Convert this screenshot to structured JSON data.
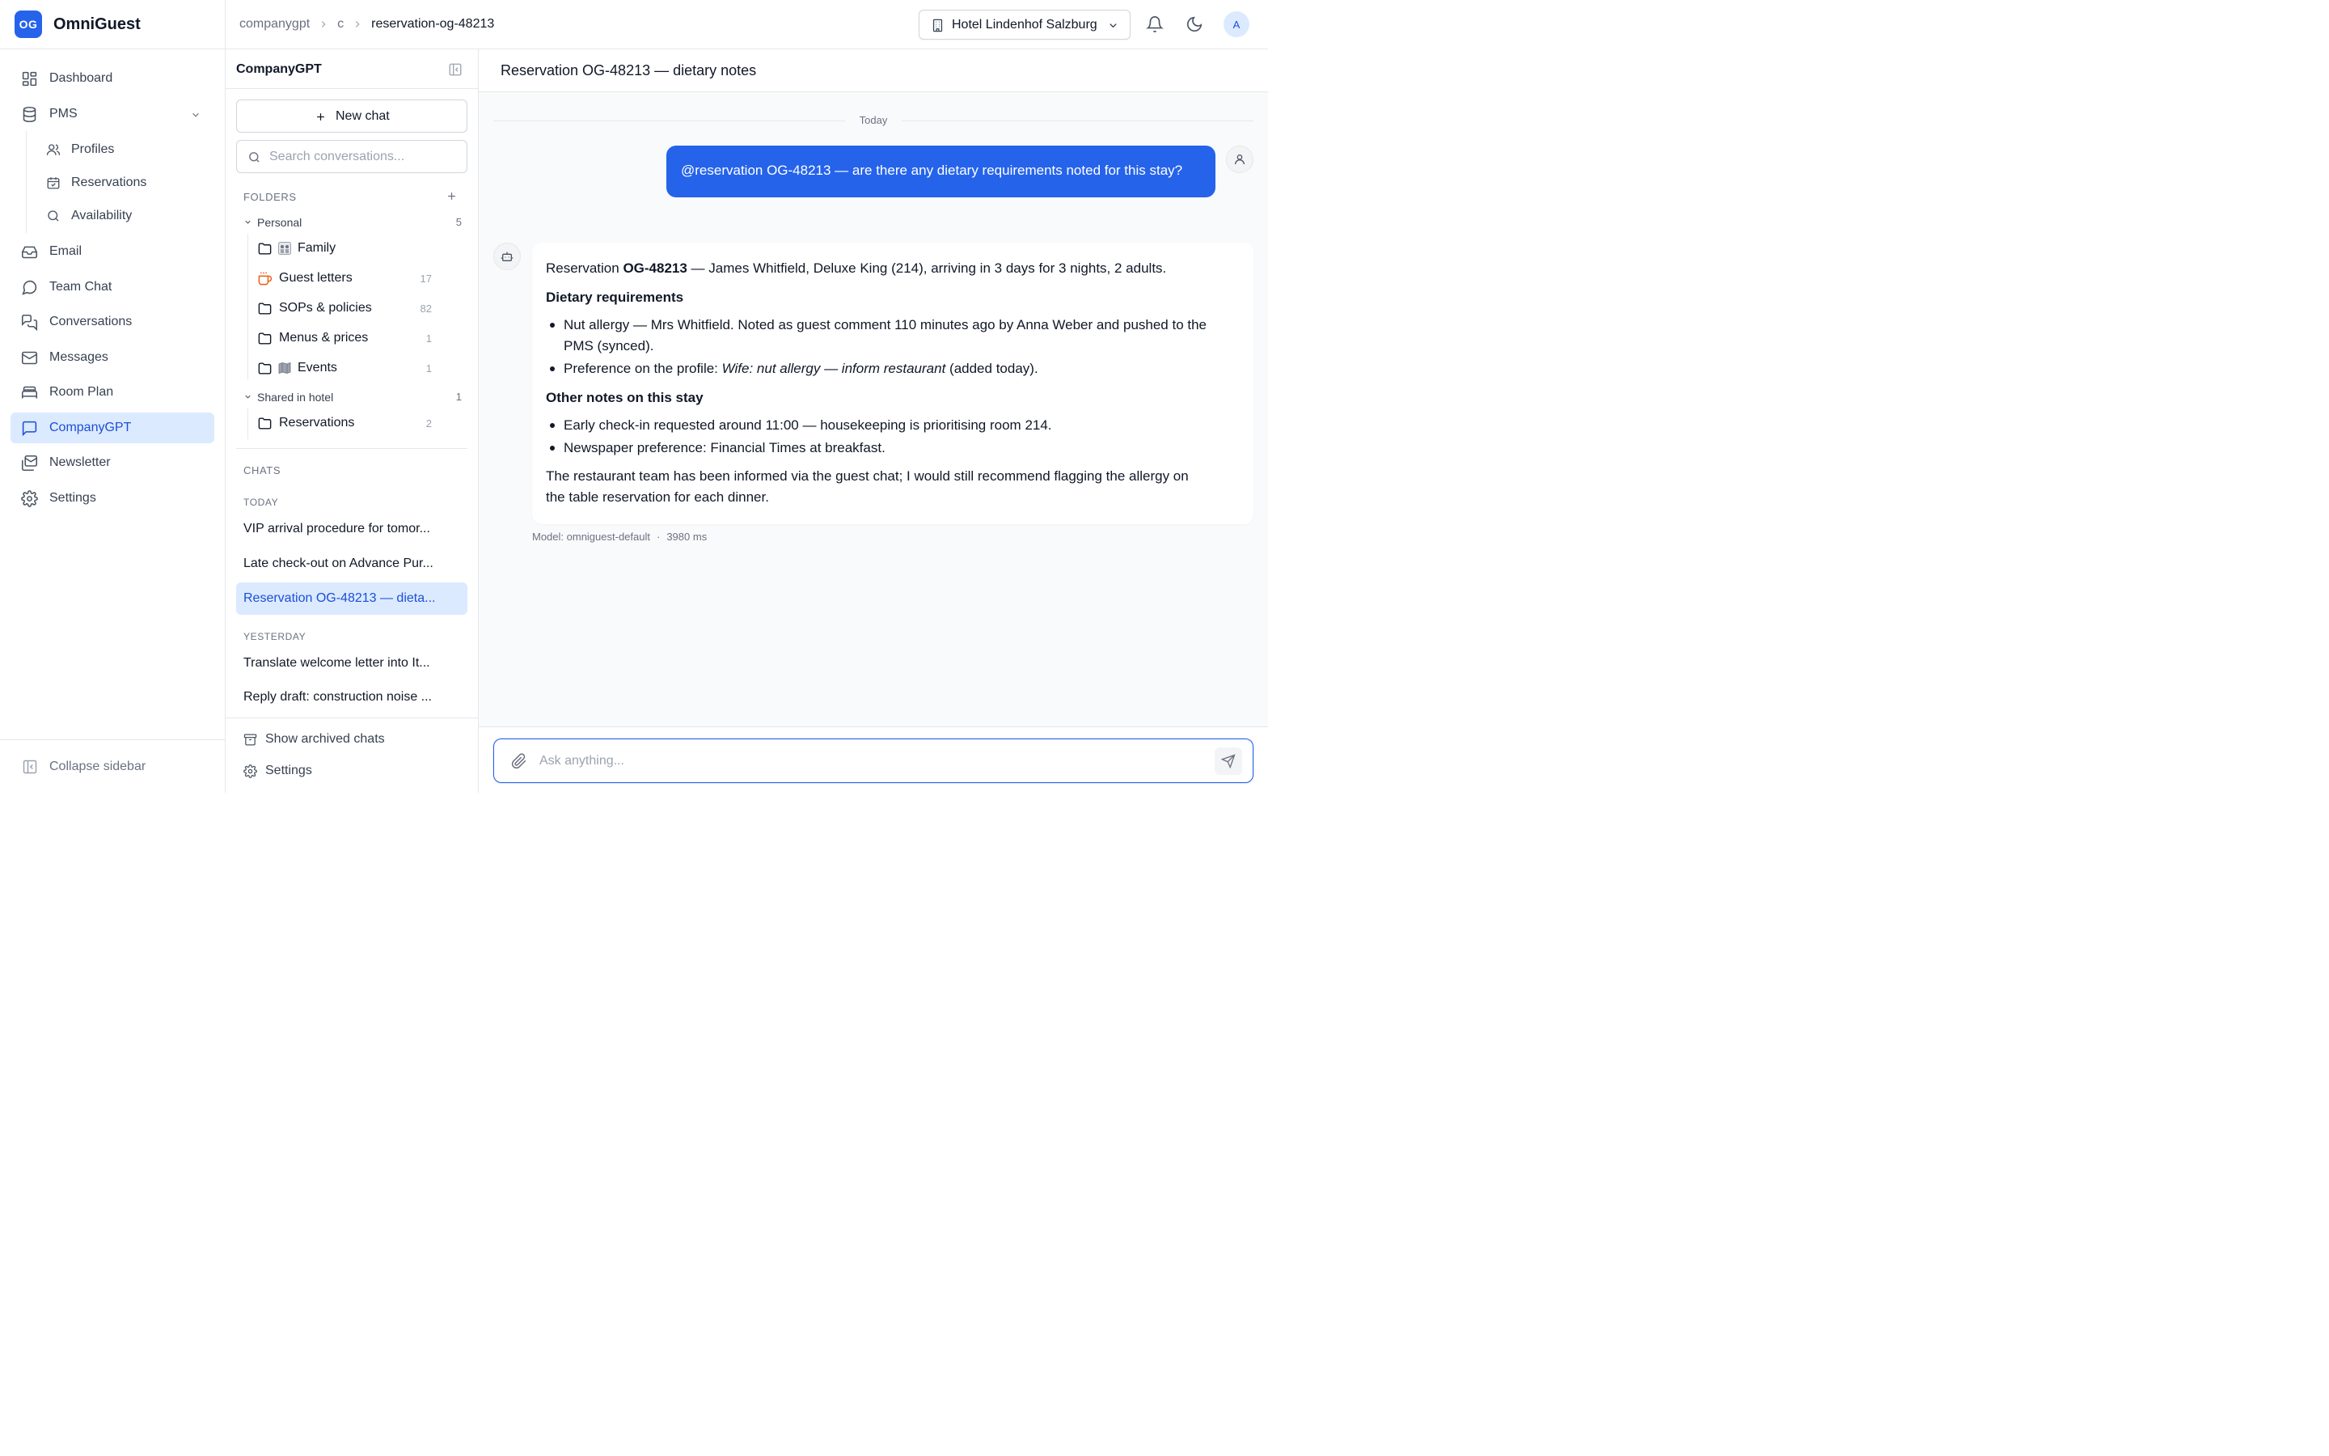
{
  "brand": {
    "logo_text": "OG",
    "name": "OmniGuest",
    "accent_color": "#2563eb"
  },
  "sidebar": {
    "items": [
      {
        "label": "Dashboard",
        "icon": "dashboard-icon"
      },
      {
        "label": "PMS",
        "icon": "database-icon",
        "expanded": true
      },
      {
        "label": "Email",
        "icon": "inbox-icon"
      },
      {
        "label": "Team Chat",
        "icon": "chat-bubble-icon"
      },
      {
        "label": "Conversations",
        "icon": "conversations-icon"
      },
      {
        "label": "Messages",
        "icon": "mail-icon"
      },
      {
        "label": "Room Plan",
        "icon": "bed-icon"
      },
      {
        "label": "CompanyGPT",
        "icon": "message-square-icon",
        "active": true
      },
      {
        "label": "Newsletter",
        "icon": "newsletter-icon"
      },
      {
        "label": "Settings",
        "icon": "gear-icon"
      }
    ],
    "pms_children": [
      {
        "label": "Profiles",
        "icon": "users-icon"
      },
      {
        "label": "Reservations",
        "icon": "calendar-check-icon"
      },
      {
        "label": "Availability",
        "icon": "search-icon"
      }
    ],
    "collapse_label": "Collapse sidebar"
  },
  "header": {
    "breadcrumb": [
      "companygpt",
      "c",
      "reservation-og-48213"
    ],
    "hotel": "Hotel Lindenhof Salzburg",
    "avatar_initial": "A"
  },
  "panel": {
    "title": "CompanyGPT",
    "new_chat_label": "New chat",
    "search_placeholder": "Search conversations...",
    "folders_label": "FOLDERS",
    "groups": [
      {
        "label": "Personal",
        "count": "5",
        "folders": [
          {
            "label": "Family",
            "count": "",
            "icon": "folder-icon",
            "emoji": "family-portrait-icon"
          },
          {
            "label": "Guest letters",
            "count": "17",
            "icon": "coffee-cup-icon"
          },
          {
            "label": "SOPs & policies",
            "count": "82",
            "icon": "folder-icon"
          },
          {
            "label": "Menus & prices",
            "count": "1",
            "icon": "folder-icon"
          },
          {
            "label": "Events",
            "count": "1",
            "icon": "folder-icon",
            "emoji": "map-icon"
          }
        ]
      },
      {
        "label": "Shared in hotel",
        "count": "1",
        "folders": [
          {
            "label": "Reservations",
            "count": "2",
            "icon": "folder-icon"
          }
        ]
      }
    ],
    "chats_label": "CHATS",
    "today_label": "TODAY",
    "yesterday_label": "YESTERDAY",
    "today_chats": [
      "VIP arrival procedure for tomor...",
      "Late check-out on Advance Pur...",
      "Reservation OG-48213 — dieta..."
    ],
    "yesterday_chats": [
      "Translate welcome letter into It...",
      "Reply draft: construction noise ..."
    ],
    "archived_label": "Show archived chats",
    "settings_label": "Settings"
  },
  "main": {
    "title": "Reservation OG-48213 — dietary notes",
    "day_label": "Today",
    "user_message": "@reservation OG-48213 — are there any dietary requirements noted for this stay?",
    "reply": {
      "intro_prefix": "Reservation ",
      "intro_bold": "OG-48213",
      "intro_suffix": " — James Whitfield, Deluxe King (214), arriving in 3 days for 3 nights, 2 adults.",
      "heading1": "Dietary requirements",
      "bullet1_line1": "Nut allergy — Mrs Whitfield. Noted as guest comment 110 minutes ago by Anna Weber and pushed to the",
      "bullet1_line2": "PMS (synced).",
      "bullet2_prefix": "Preference on the profile: ",
      "bullet2_italic": "Wife: nut allergy — inform restaurant",
      "bullet2_suffix": " (added today).",
      "heading2": "Other notes on this stay",
      "bullet3": "Early check-in requested around 11:00 — housekeeping is prioritising room 214.",
      "bullet4": "Newspaper preference: Financial Times at breakfast.",
      "closing_line1": "The restaurant team has been informed via the guest chat; I would still recommend flagging the allergy on",
      "closing_line2": "the table reservation for each dinner."
    },
    "meta_model": "Model: omniguest-default",
    "meta_sep": "·",
    "meta_latency": "3980 ms",
    "composer_placeholder": "Ask anything..."
  }
}
